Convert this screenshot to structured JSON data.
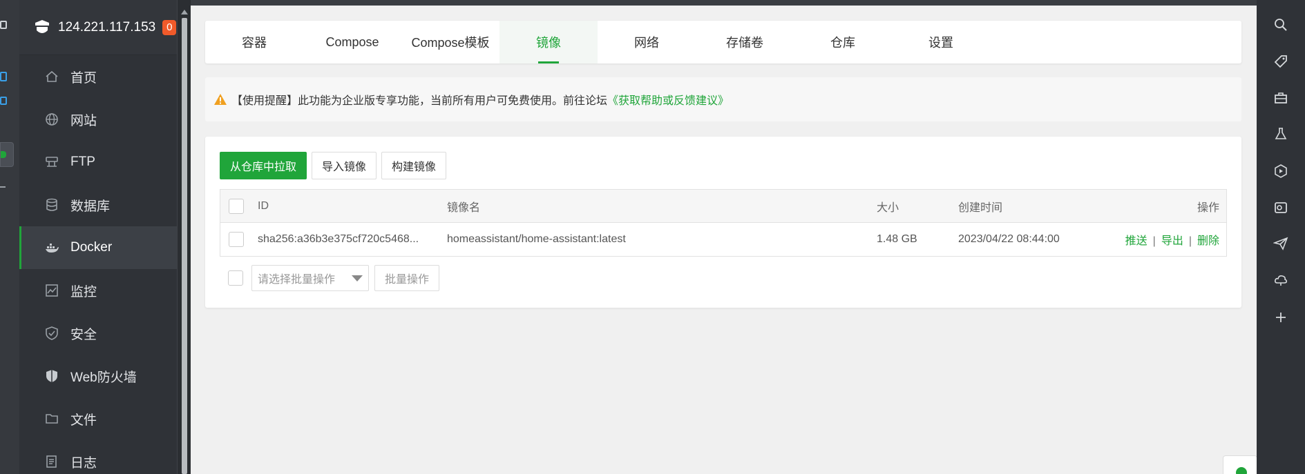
{
  "sidebar": {
    "host": "124.221.117.153",
    "badge": "0",
    "items": [
      {
        "label": "首页",
        "icon": "home-icon"
      },
      {
        "label": "网站",
        "icon": "globe-icon"
      },
      {
        "label": "FTP",
        "icon": "ftp-icon"
      },
      {
        "label": "数据库",
        "icon": "database-icon"
      },
      {
        "label": "Docker",
        "icon": "docker-icon"
      },
      {
        "label": "监控",
        "icon": "monitor-icon"
      },
      {
        "label": "安全",
        "icon": "shield-icon"
      },
      {
        "label": "Web防火墙",
        "icon": "firewall-icon"
      },
      {
        "label": "文件",
        "icon": "folder-icon"
      },
      {
        "label": "日志",
        "icon": "log-icon"
      }
    ],
    "active_index": 4
  },
  "tabs": [
    "容器",
    "Compose",
    "Compose模板",
    "镜像",
    "网络",
    "存储卷",
    "仓库",
    "设置"
  ],
  "active_tab": "镜像",
  "notice": {
    "text": "【使用提醒】此功能为企业版专享功能，当前所有用户可免费使用。前往论坛",
    "link": "《获取帮助或反馈建议》"
  },
  "actions": {
    "pull": "从仓库中拉取",
    "import": "导入镜像",
    "build": "构建镜像"
  },
  "table": {
    "headers": {
      "id": "ID",
      "name": "镜像名",
      "size": "大小",
      "time": "创建时间",
      "ops": "操作"
    },
    "rows": [
      {
        "id": "sha256:a36b3e375cf720c5468...",
        "name": "homeassistant/home-assistant:latest",
        "size": "1.48 GB",
        "time": "2023/04/22 08:44:00",
        "ops": [
          "推送",
          "导出",
          "删除"
        ],
        "sep": "|"
      }
    ]
  },
  "batch": {
    "placeholder": "请选择批量操作",
    "button": "批量操作"
  },
  "colors": {
    "accent": "#20a53a",
    "badge": "#f05a2a",
    "warning": "#f0a020"
  }
}
